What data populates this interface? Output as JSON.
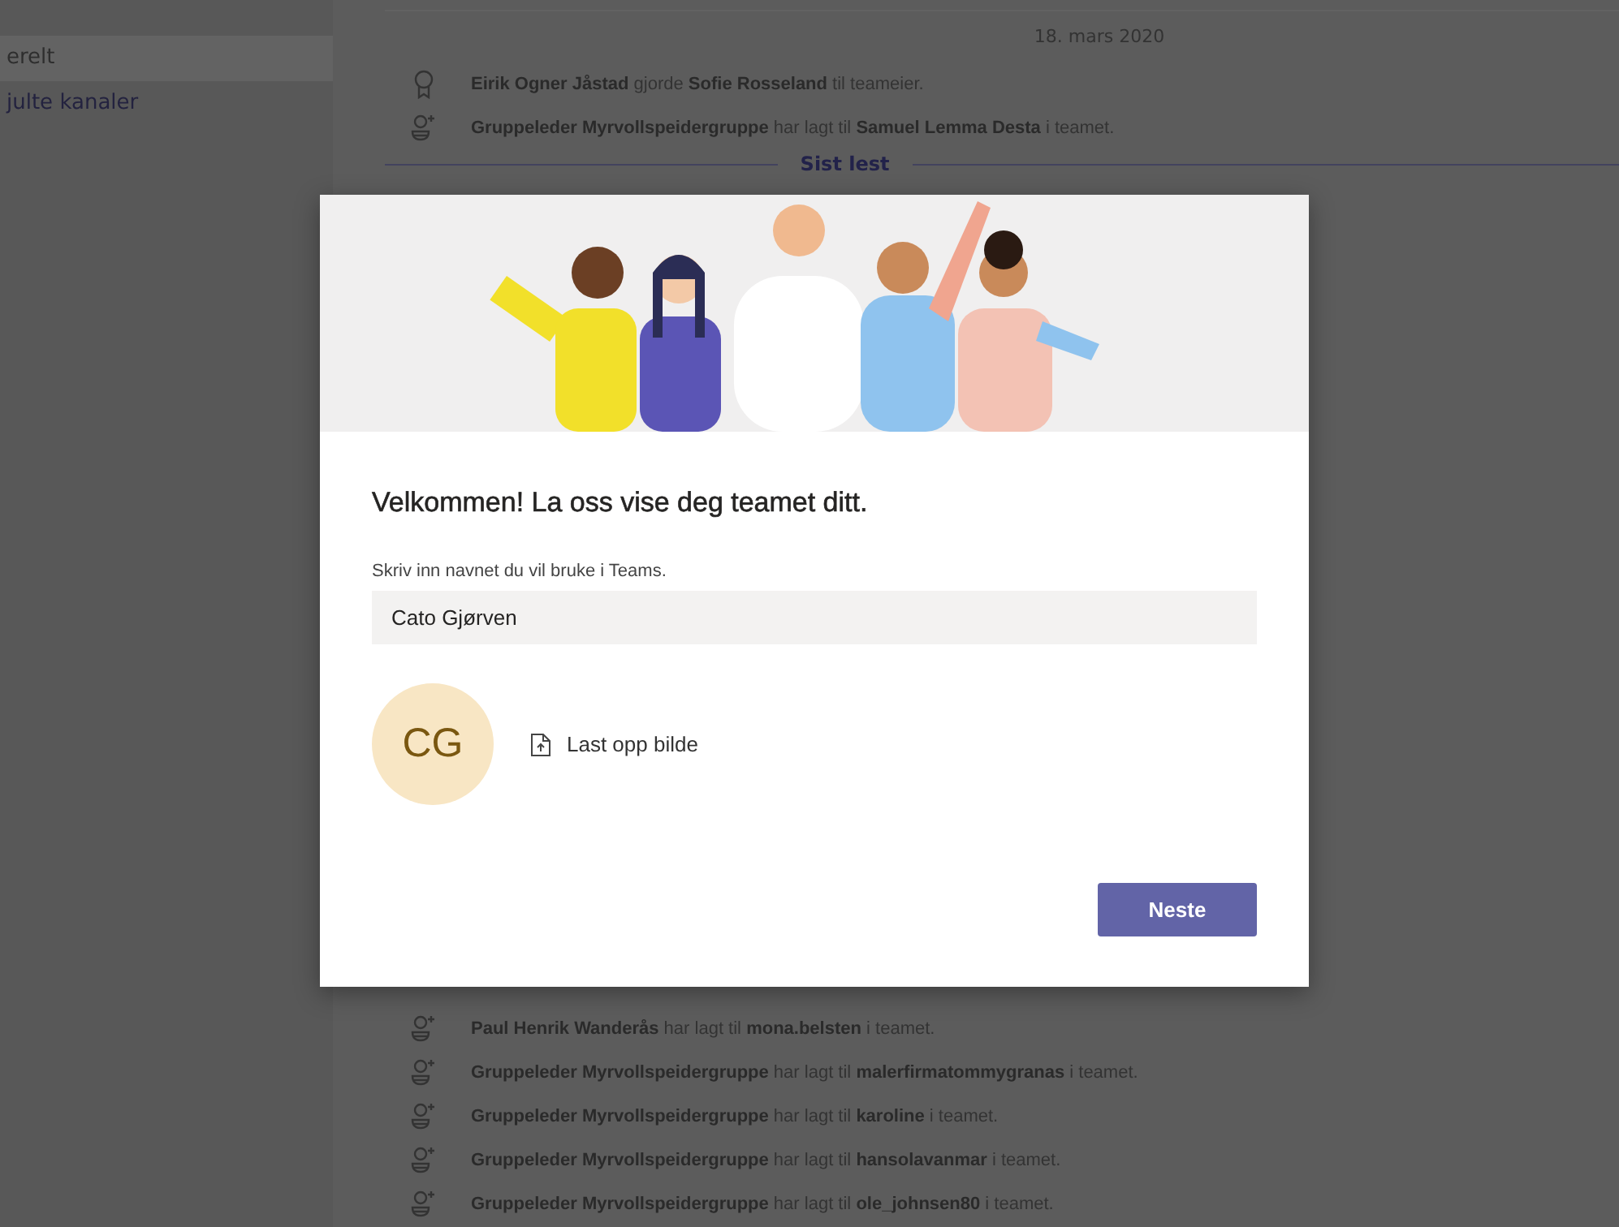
{
  "sidebar": {
    "items": [
      {
        "label": "erelt",
        "selected": true
      },
      {
        "label": "julte kanaler",
        "selected": false
      }
    ]
  },
  "feed": {
    "date": "18. mars 2020",
    "top_events": [
      {
        "kind": "owner",
        "text": "**Eirik Ogner Jåstad** gjorde **Sofie Rosseland** til teameier."
      },
      {
        "kind": "member_added",
        "text": "**Gruppeleder Myrvollspeidergruppe** har lagt til **Samuel Lemma Desta** i teamet."
      }
    ],
    "last_read": "Sist lest",
    "bottom_events": [
      {
        "kind": "member_added",
        "text": "**Paul Henrik Wanderås** har lagt til **mona.belsten** i teamet."
      },
      {
        "kind": "member_added",
        "text": "**Gruppeleder Myrvollspeidergruppe** har lagt til **malerfirmatommygranas** i teamet."
      },
      {
        "kind": "member_added",
        "text": "**Gruppeleder Myrvollspeidergruppe** har lagt til **karoline** i teamet."
      },
      {
        "kind": "member_added",
        "text": "**Gruppeleder Myrvollspeidergruppe** har lagt til **hansolavanmar** i teamet."
      },
      {
        "kind": "member_added",
        "text": "**Gruppeleder Myrvollspeidergruppe** har lagt til **ole_johnsen80** i teamet."
      }
    ]
  },
  "dialog": {
    "title": "Velkommen! La oss vise deg teamet ditt.",
    "name_label": "Skriv inn navnet du vil bruke i Teams.",
    "name_value": "Cato Gjørven",
    "avatar_initials": "CG",
    "upload_label": "Last opp bilde",
    "next_button": "Neste"
  }
}
